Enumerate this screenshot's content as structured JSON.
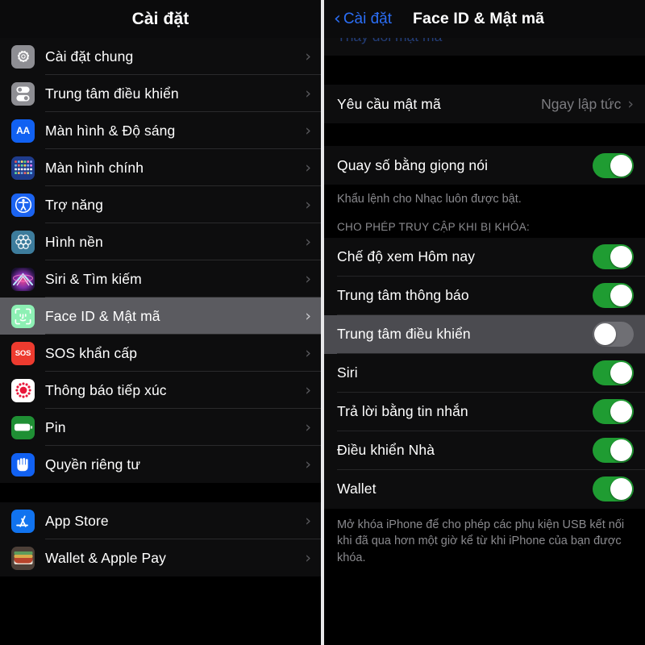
{
  "colors": {
    "accent_blue": "#2b6ef5",
    "toggle_on_green": "#1f9c32",
    "toggle_off_gray": "#6f6f74",
    "panel_bg": "#0d0d0e",
    "page_bg": "#000000",
    "selected_row_left": "#5b5b60",
    "selected_row_right": "#4b4b50",
    "secondary_text": "#8a8a8e",
    "divider": "#e8e8ea"
  },
  "left_panel": {
    "title": "Cài đặt",
    "groups": [
      {
        "items": [
          {
            "label": "Cài đặt chung",
            "icon": "gear-icon",
            "selected": false,
            "chevron": "›"
          },
          {
            "label": "Trung tâm điều khiển",
            "icon": "control-center-icon",
            "selected": false,
            "chevron": "›"
          },
          {
            "label": "Màn hình & Độ sáng",
            "icon": "display-brightness-icon",
            "selected": false,
            "chevron": "›"
          },
          {
            "label": "Màn hình chính",
            "icon": "home-screen-icon",
            "selected": false,
            "chevron": "›"
          },
          {
            "label": "Trợ năng",
            "icon": "accessibility-icon",
            "selected": false,
            "chevron": "›"
          },
          {
            "label": "Hình nền",
            "icon": "wallpaper-icon",
            "selected": false,
            "chevron": "›"
          },
          {
            "label": "Siri & Tìm kiếm",
            "icon": "siri-icon",
            "selected": false,
            "chevron": "›"
          },
          {
            "label": "Face ID & Mật mã",
            "icon": "face-id-icon",
            "selected": true,
            "chevron": "›"
          },
          {
            "label": "SOS khẩn cấp",
            "icon": "sos-icon",
            "selected": false,
            "chevron": "›"
          },
          {
            "label": "Thông báo tiếp xúc",
            "icon": "exposure-notification-icon",
            "selected": false,
            "chevron": "›"
          },
          {
            "label": "Pin",
            "icon": "battery-icon",
            "selected": false,
            "chevron": "›"
          },
          {
            "label": "Quyền riêng tư",
            "icon": "privacy-hand-icon",
            "selected": false,
            "chevron": "›"
          }
        ]
      },
      {
        "items": [
          {
            "label": "App Store",
            "icon": "app-store-icon",
            "selected": false,
            "chevron": "›"
          },
          {
            "label": "Wallet & Apple Pay",
            "icon": "wallet-icon",
            "selected": false,
            "chevron": "›"
          }
        ]
      }
    ]
  },
  "right_panel": {
    "back_label": "Cài đặt",
    "back_chevron": "‹",
    "title": "Face ID & Mật mã",
    "clipped_top_row": "Thay đổi mật mã",
    "rows": [
      {
        "label": "Yêu cầu mật mã",
        "type": "value",
        "value": "Ngay lập tức",
        "chevron": "›",
        "selected": false
      },
      {
        "label": "Quay số bằng giọng nói",
        "type": "toggle",
        "on": true,
        "selected": false
      }
    ],
    "voice_dial_footnote": "Khẩu lệnh cho Nhạc luôn được bật.",
    "section_header": "CHO PHÉP TRUY CẬP KHI BỊ KHÓA:",
    "access_rows": [
      {
        "label": "Chế độ xem Hôm nay",
        "type": "toggle",
        "on": true,
        "selected": false
      },
      {
        "label": "Trung tâm thông báo",
        "type": "toggle",
        "on": true,
        "selected": false
      },
      {
        "label": "Trung tâm điều khiển",
        "type": "toggle",
        "on": false,
        "selected": true
      },
      {
        "label": "Siri",
        "type": "toggle",
        "on": true,
        "selected": false
      },
      {
        "label": "Trả lời bằng tin nhắn",
        "type": "toggle",
        "on": true,
        "selected": false
      },
      {
        "label": "Điều khiển Nhà",
        "type": "toggle",
        "on": true,
        "selected": false
      },
      {
        "label": "Wallet",
        "type": "toggle",
        "on": true,
        "selected": false
      }
    ],
    "bottom_footnote": "Mở khóa iPhone để cho phép các phụ kiện USB kết nối khi đã qua hơn một giờ kể từ khi iPhone của bạn được khóa."
  }
}
